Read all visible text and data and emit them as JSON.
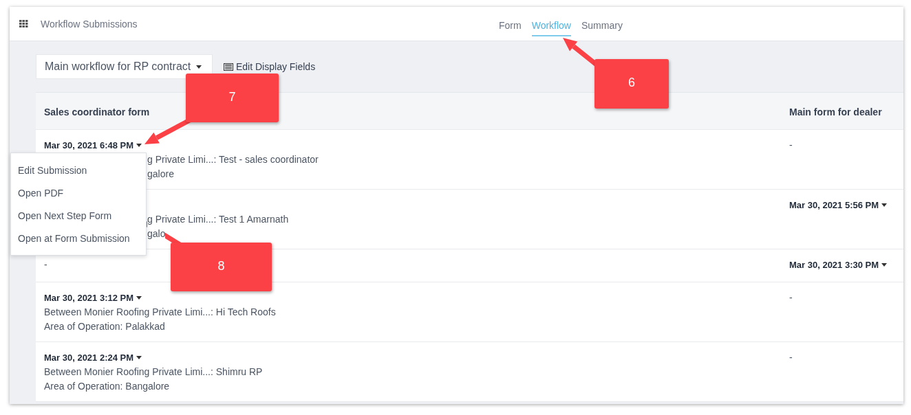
{
  "header": {
    "title": "Workflow Submissions"
  },
  "tabs": [
    {
      "label": "Form",
      "selected": false
    },
    {
      "label": "Workflow",
      "selected": true
    },
    {
      "label": "Summary",
      "selected": false
    }
  ],
  "toolbar": {
    "workflow_select": "Main workflow for RP contract",
    "edit_fields": "Edit Display Fields"
  },
  "table": {
    "columns": [
      "Sales coordinator form",
      "Main form for dealer"
    ],
    "rows": [
      {
        "left": {
          "kind": "partly_hidden",
          "date": "Mar 30, 2021 6:48 PM",
          "lines": [
            "g Private Limi...: Test - sales coordinator",
            "galore"
          ]
        },
        "right": {
          "text": "-"
        }
      },
      {
        "left": {
          "kind": "partly_hidden",
          "lines": [
            "g Private Limi...: Test 1 Amarnath",
            "galo"
          ]
        },
        "right": {
          "date": "Mar 30, 2021 5:56 PM"
        }
      },
      {
        "left": {
          "kind": "full",
          "text": "-"
        },
        "right": {
          "date": "Mar 30, 2021 3:30 PM"
        }
      },
      {
        "left": {
          "kind": "full",
          "date": "Mar 30, 2021 3:12 PM",
          "lines": [
            "Between Monier Roofing Private Limi...: Hi Tech Roofs",
            "Area of Operation: Palakkad"
          ]
        },
        "right": {
          "text": "-"
        }
      },
      {
        "left": {
          "kind": "full",
          "date": "Mar 30, 2021 2:24 PM",
          "lines": [
            "Between Monier Roofing Private Limi...: Shimru RP",
            "Area of Operation: Bangalore"
          ]
        },
        "right": {
          "text": "-"
        }
      }
    ]
  },
  "menu": {
    "items": [
      "Edit Submission",
      "Open PDF",
      "Open Next Step Form",
      "Open at Form Submission"
    ]
  },
  "callouts": [
    {
      "label": "7"
    },
    {
      "label": "6"
    },
    {
      "label": "8"
    }
  ]
}
